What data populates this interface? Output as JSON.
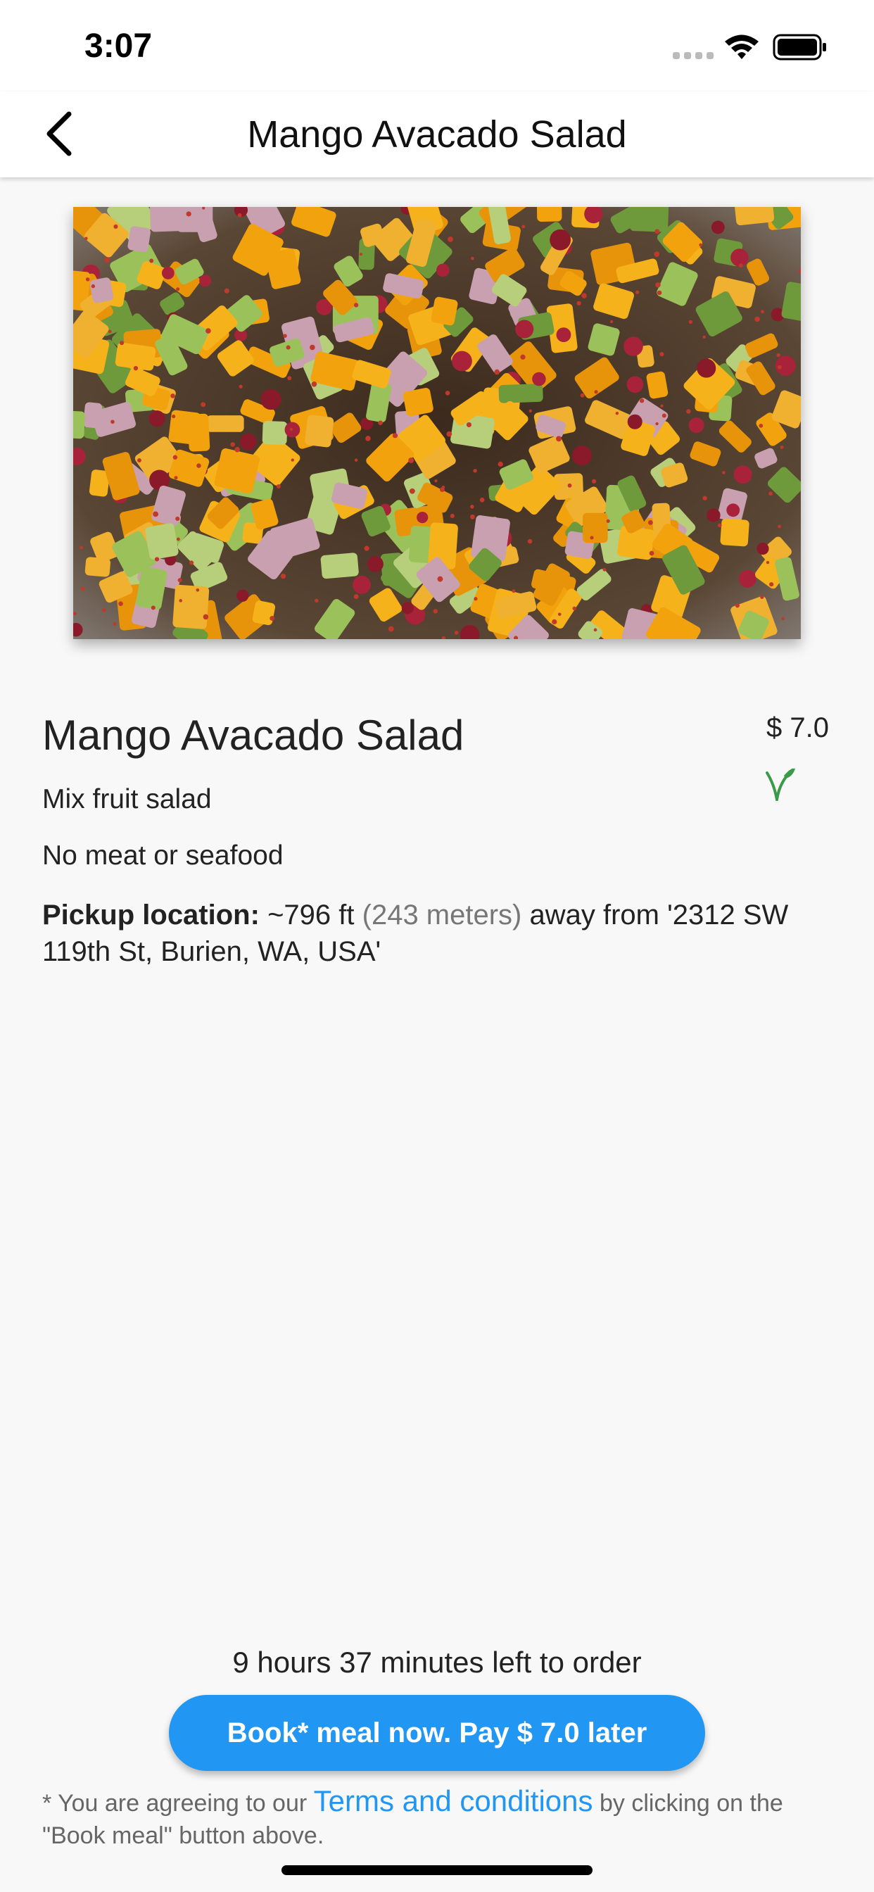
{
  "status_bar": {
    "time": "3:07",
    "icons": [
      "signal-icon",
      "wifi-icon",
      "battery-icon"
    ]
  },
  "nav": {
    "back_icon": "chevron-left-icon",
    "title": "Mango Avacado Salad"
  },
  "meal": {
    "image_alt": "salad-photo",
    "title": "Mango Avacado Salad",
    "price": "$ 7.0",
    "veg_icon": "vegan-leaf-icon",
    "description": "Mix fruit salad",
    "diet_note": "No meat or seafood",
    "pickup": {
      "label": "Pickup location:",
      "distance_ft": "~796 ft",
      "distance_m": "(243 meters)",
      "away_text": "away from",
      "address": "'2312 SW 119th St, Burien, WA, USA'"
    }
  },
  "footer": {
    "time_left": "9 hours 37 minutes left to order",
    "book_button": "Book* meal now. Pay $  7.0 later",
    "terms_prefix": "* You are agreeing to our",
    "terms_link": "Terms and conditions",
    "terms_suffix": "by clicking on the \"Book meal\" button above."
  },
  "colors": {
    "accent": "#2196f3",
    "veg_green": "#3a9a4a",
    "background": "#f8f8f8"
  }
}
